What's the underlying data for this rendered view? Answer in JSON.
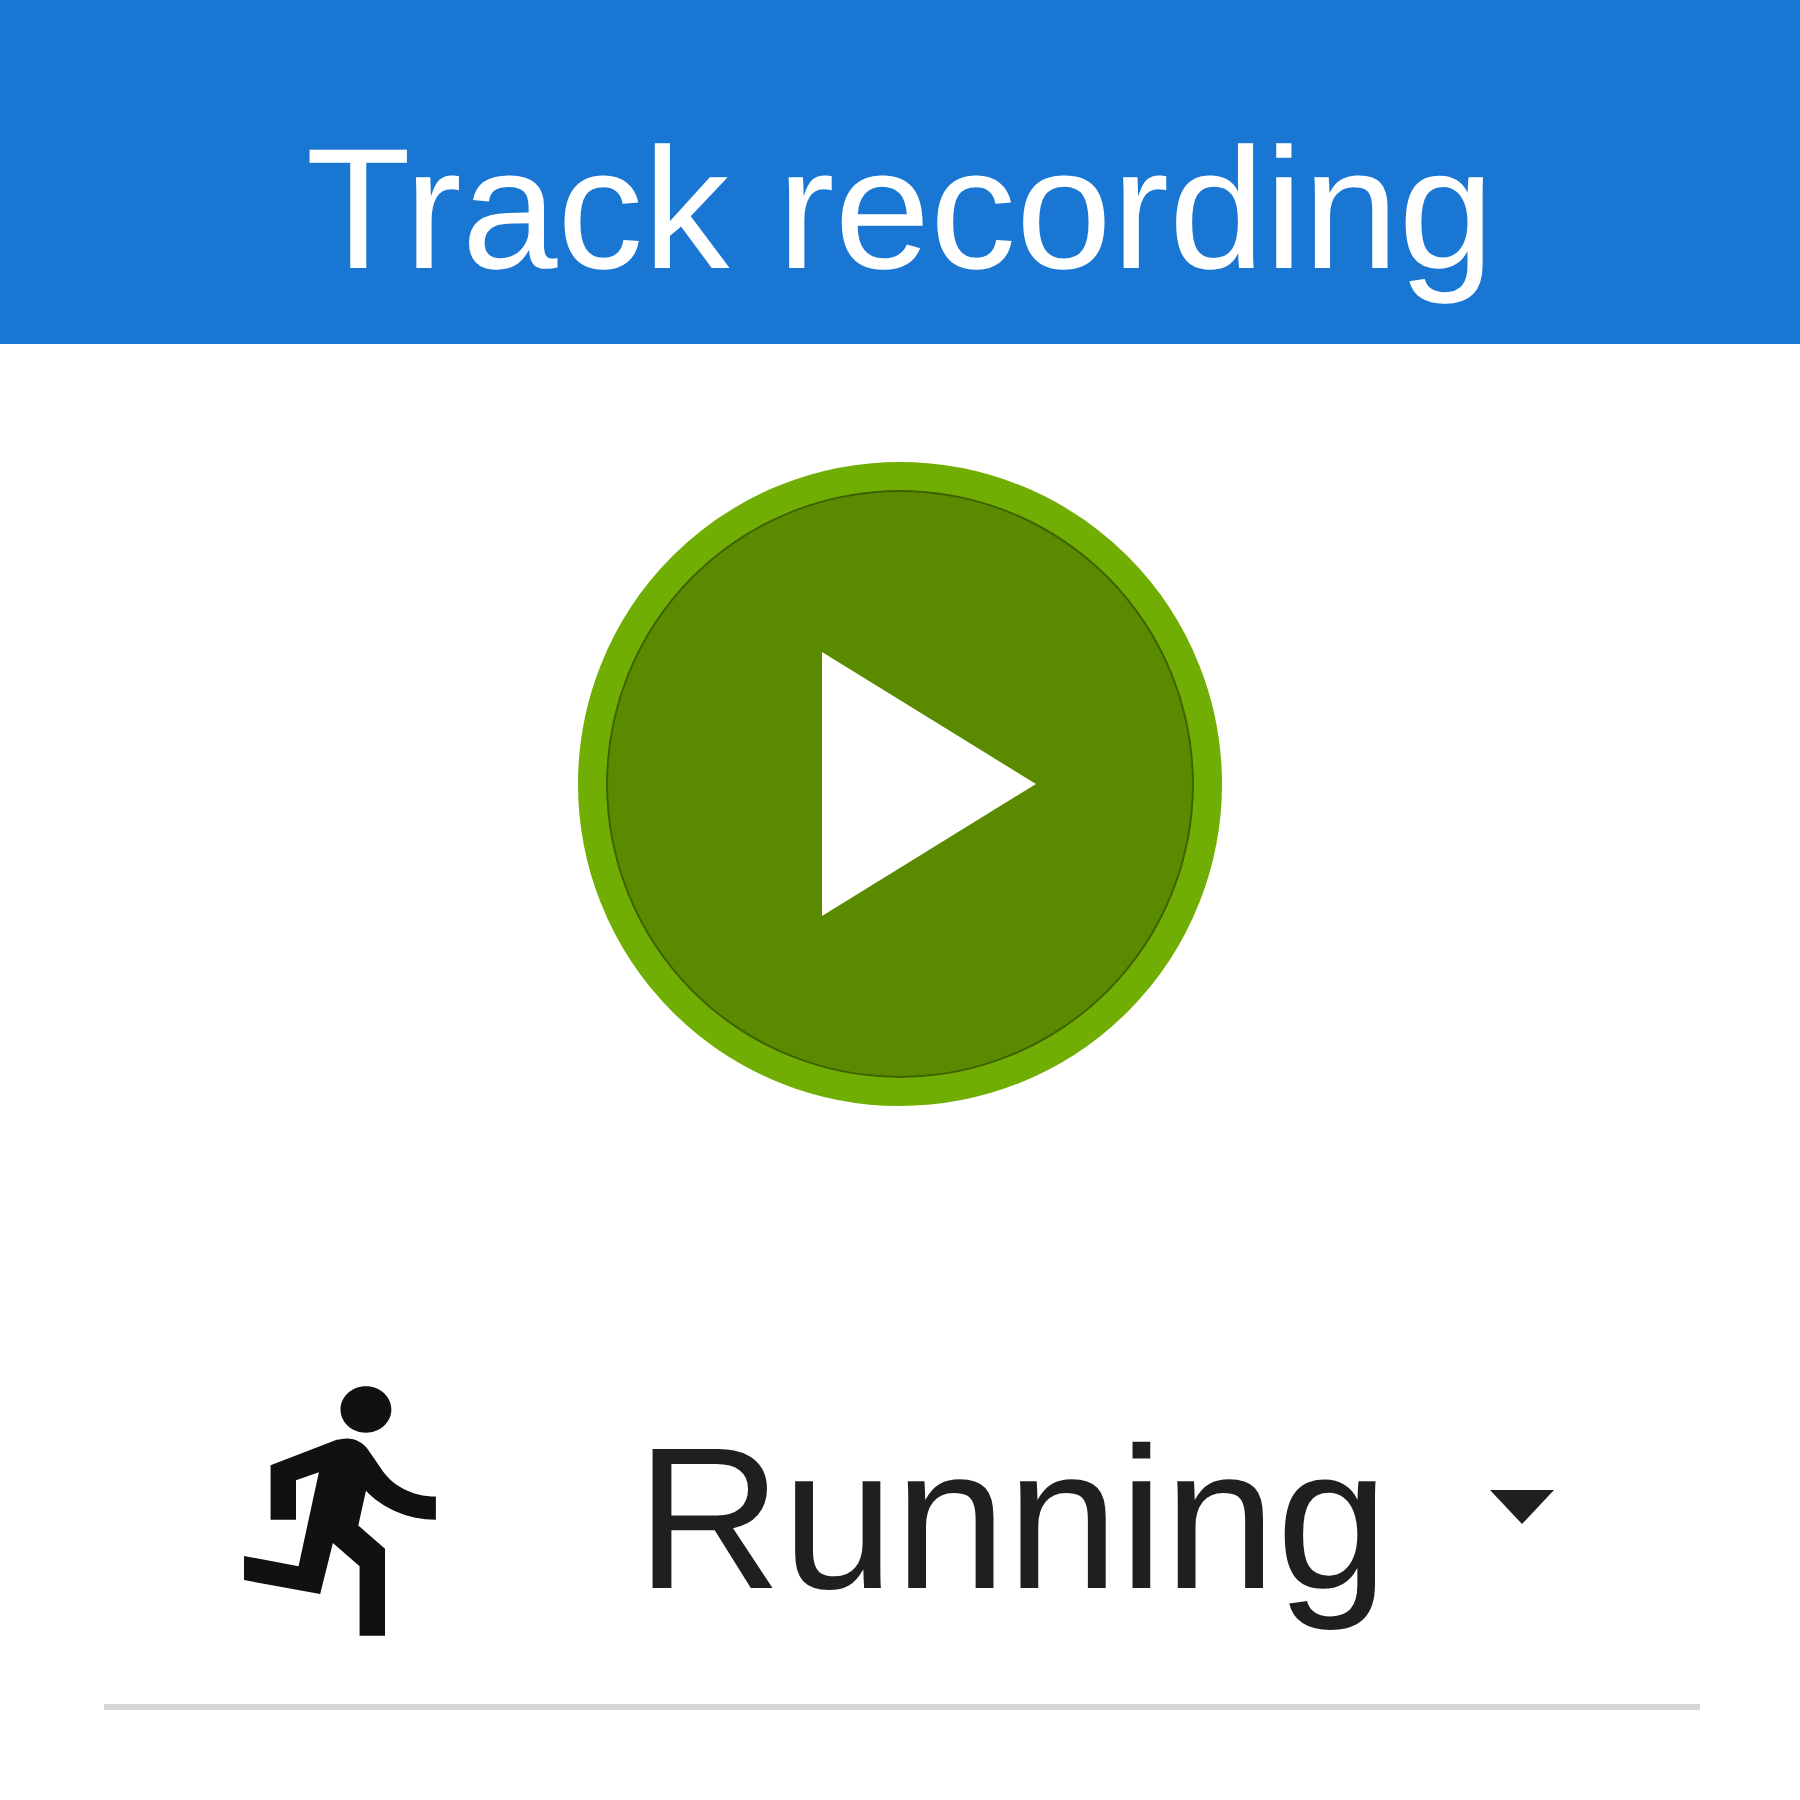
{
  "header": {
    "title": "Track recording"
  },
  "activity_dropdown": {
    "value": "Running"
  }
}
